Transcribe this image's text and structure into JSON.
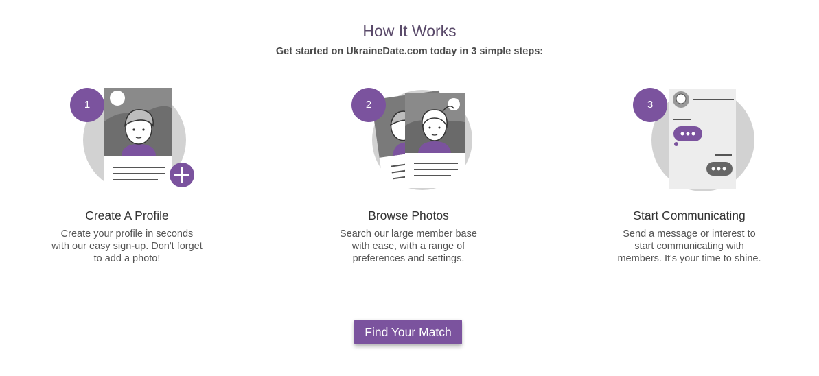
{
  "header": {
    "title": "How It Works",
    "subtitle": "Get started on UkraineDate.com today in 3 simple steps:"
  },
  "steps": [
    {
      "number": "1",
      "title": "Create A Profile",
      "description": "Create your profile in seconds with our easy sign-up. Don't forget to add a photo!",
      "illustration": "profile-card-add-photo-icon"
    },
    {
      "number": "2",
      "title": "Browse Photos",
      "description": "Search our large member base with ease, with a range of preferences and settings.",
      "illustration": "photo-cards-browse-icon"
    },
    {
      "number": "3",
      "title": "Start Communicating",
      "description": "Send a message or interest to start communicating with members. It's your time to shine.",
      "illustration": "chat-conversation-icon"
    }
  ],
  "cta": {
    "label": "Find Your Match"
  },
  "colors": {
    "accent": "#7b539e",
    "title": "#5a4a6a",
    "circle_bg": "#d2d2d2",
    "card_dark": "#777777"
  }
}
